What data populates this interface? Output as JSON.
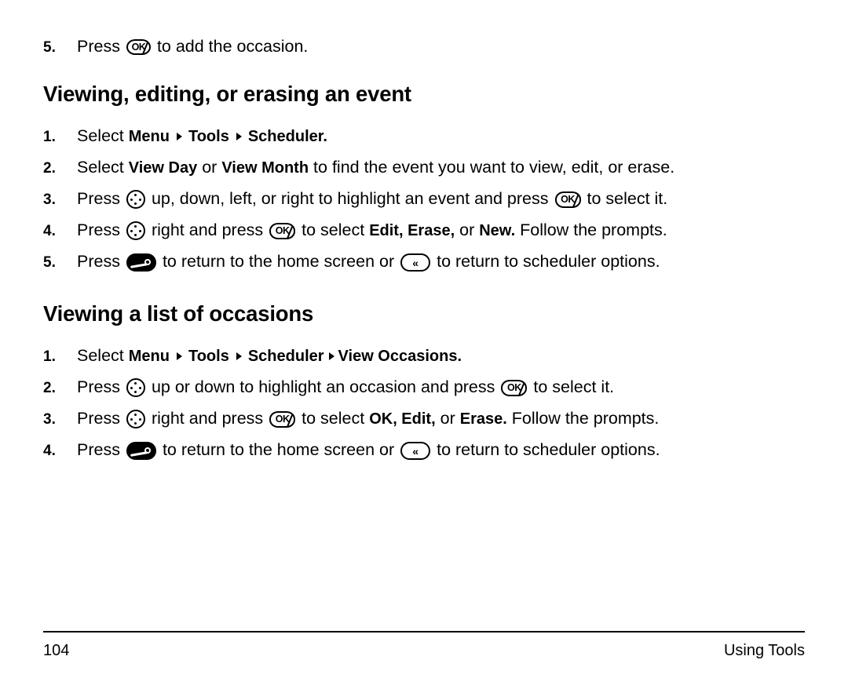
{
  "page": {
    "number": "104",
    "section_label": "Using Tools"
  },
  "top_step": {
    "num": "5.",
    "pre": "Press",
    "post": "to add the occasion."
  },
  "sections": [
    {
      "heading": "Viewing, editing, or erasing an event",
      "steps": [
        {
          "num": "1.",
          "pre": "Select",
          "menu_path": [
            "Menu",
            "Tools",
            "Scheduler."
          ],
          "post": ""
        },
        {
          "num": "2.",
          "pre": "Select",
          "bold1": "View Day",
          "mid": "or",
          "bold2": "View Month",
          "post": "to find the event you want to view, edit, or erase."
        },
        {
          "num": "3.",
          "pre": "Press",
          "mid": "up, down, left, or right to highlight an event and press",
          "post": "to select it."
        },
        {
          "num": "4.",
          "pre": "Press",
          "mid": "right and press",
          "mid2": "to select",
          "bold1": "Edit, Erase,",
          "mid3": "or",
          "bold2": "New.",
          "post": "Follow the prompts."
        },
        {
          "num": "5.",
          "pre": "Press",
          "mid": "to return to the home screen or",
          "post": "to return to scheduler options."
        }
      ]
    },
    {
      "heading": "Viewing a list of occasions",
      "steps": [
        {
          "num": "1.",
          "pre": "Select",
          "menu_path": [
            "Menu",
            "Tools",
            "Scheduler",
            "View Occasions."
          ],
          "post": ""
        },
        {
          "num": "2.",
          "pre": "Press",
          "mid": "up or down to highlight an occasion and press",
          "post": "to select it."
        },
        {
          "num": "3.",
          "pre": "Press",
          "mid": "right and press",
          "mid2": "to select",
          "bold1": "OK, Edit,",
          "mid3": "or",
          "bold2": "Erase.",
          "post": "Follow the prompts."
        },
        {
          "num": "4.",
          "pre": "Press",
          "mid": "to return to the home screen or",
          "post": "to return to scheduler options."
        }
      ]
    }
  ],
  "icons": {
    "ok_key": "ok-key-icon",
    "nav_key": "navigation-key-icon",
    "end_key": "end-key-icon",
    "back_key": "back-key-icon",
    "ok_label": "OK",
    "back_label": "«"
  }
}
